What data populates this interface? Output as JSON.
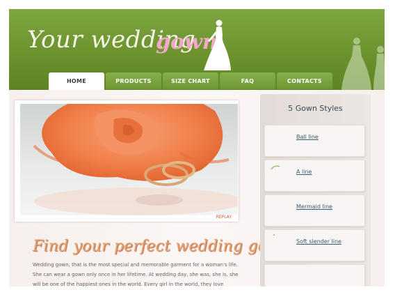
{
  "header": {
    "logo_part1": "Your wedding",
    "logo_part2": "gown"
  },
  "nav": {
    "items": [
      "HOME",
      "PRODUCTS",
      "SIZE CHART",
      "FAQ",
      "CONTACTS"
    ],
    "active": "HOME"
  },
  "slideshow": {
    "replay_label": "REPLAY"
  },
  "intro": {
    "headline": "Find your perfect wedding gown",
    "text": "Wedding gown, that is the most special and memorable garment for a woman's life. She can wear a gown only once in her lifetime. At wedding day, she was, she is, she will be one of the happiest ones in the world. Every girl in the world, they love drawing pictures of a bride and dream to be a happiest bride wearing a beautiful wedding gown."
  },
  "sidebar": {
    "title": "5 Gown Styles",
    "links": [
      "Ball line",
      "A line",
      "Mermaid line",
      "Soft slender line"
    ]
  },
  "colors": {
    "header_green": "#6f9630",
    "logo_pink": "#f2a9c8",
    "headline_orange": "#e6a070",
    "link_blue": "#3a5a6e"
  }
}
